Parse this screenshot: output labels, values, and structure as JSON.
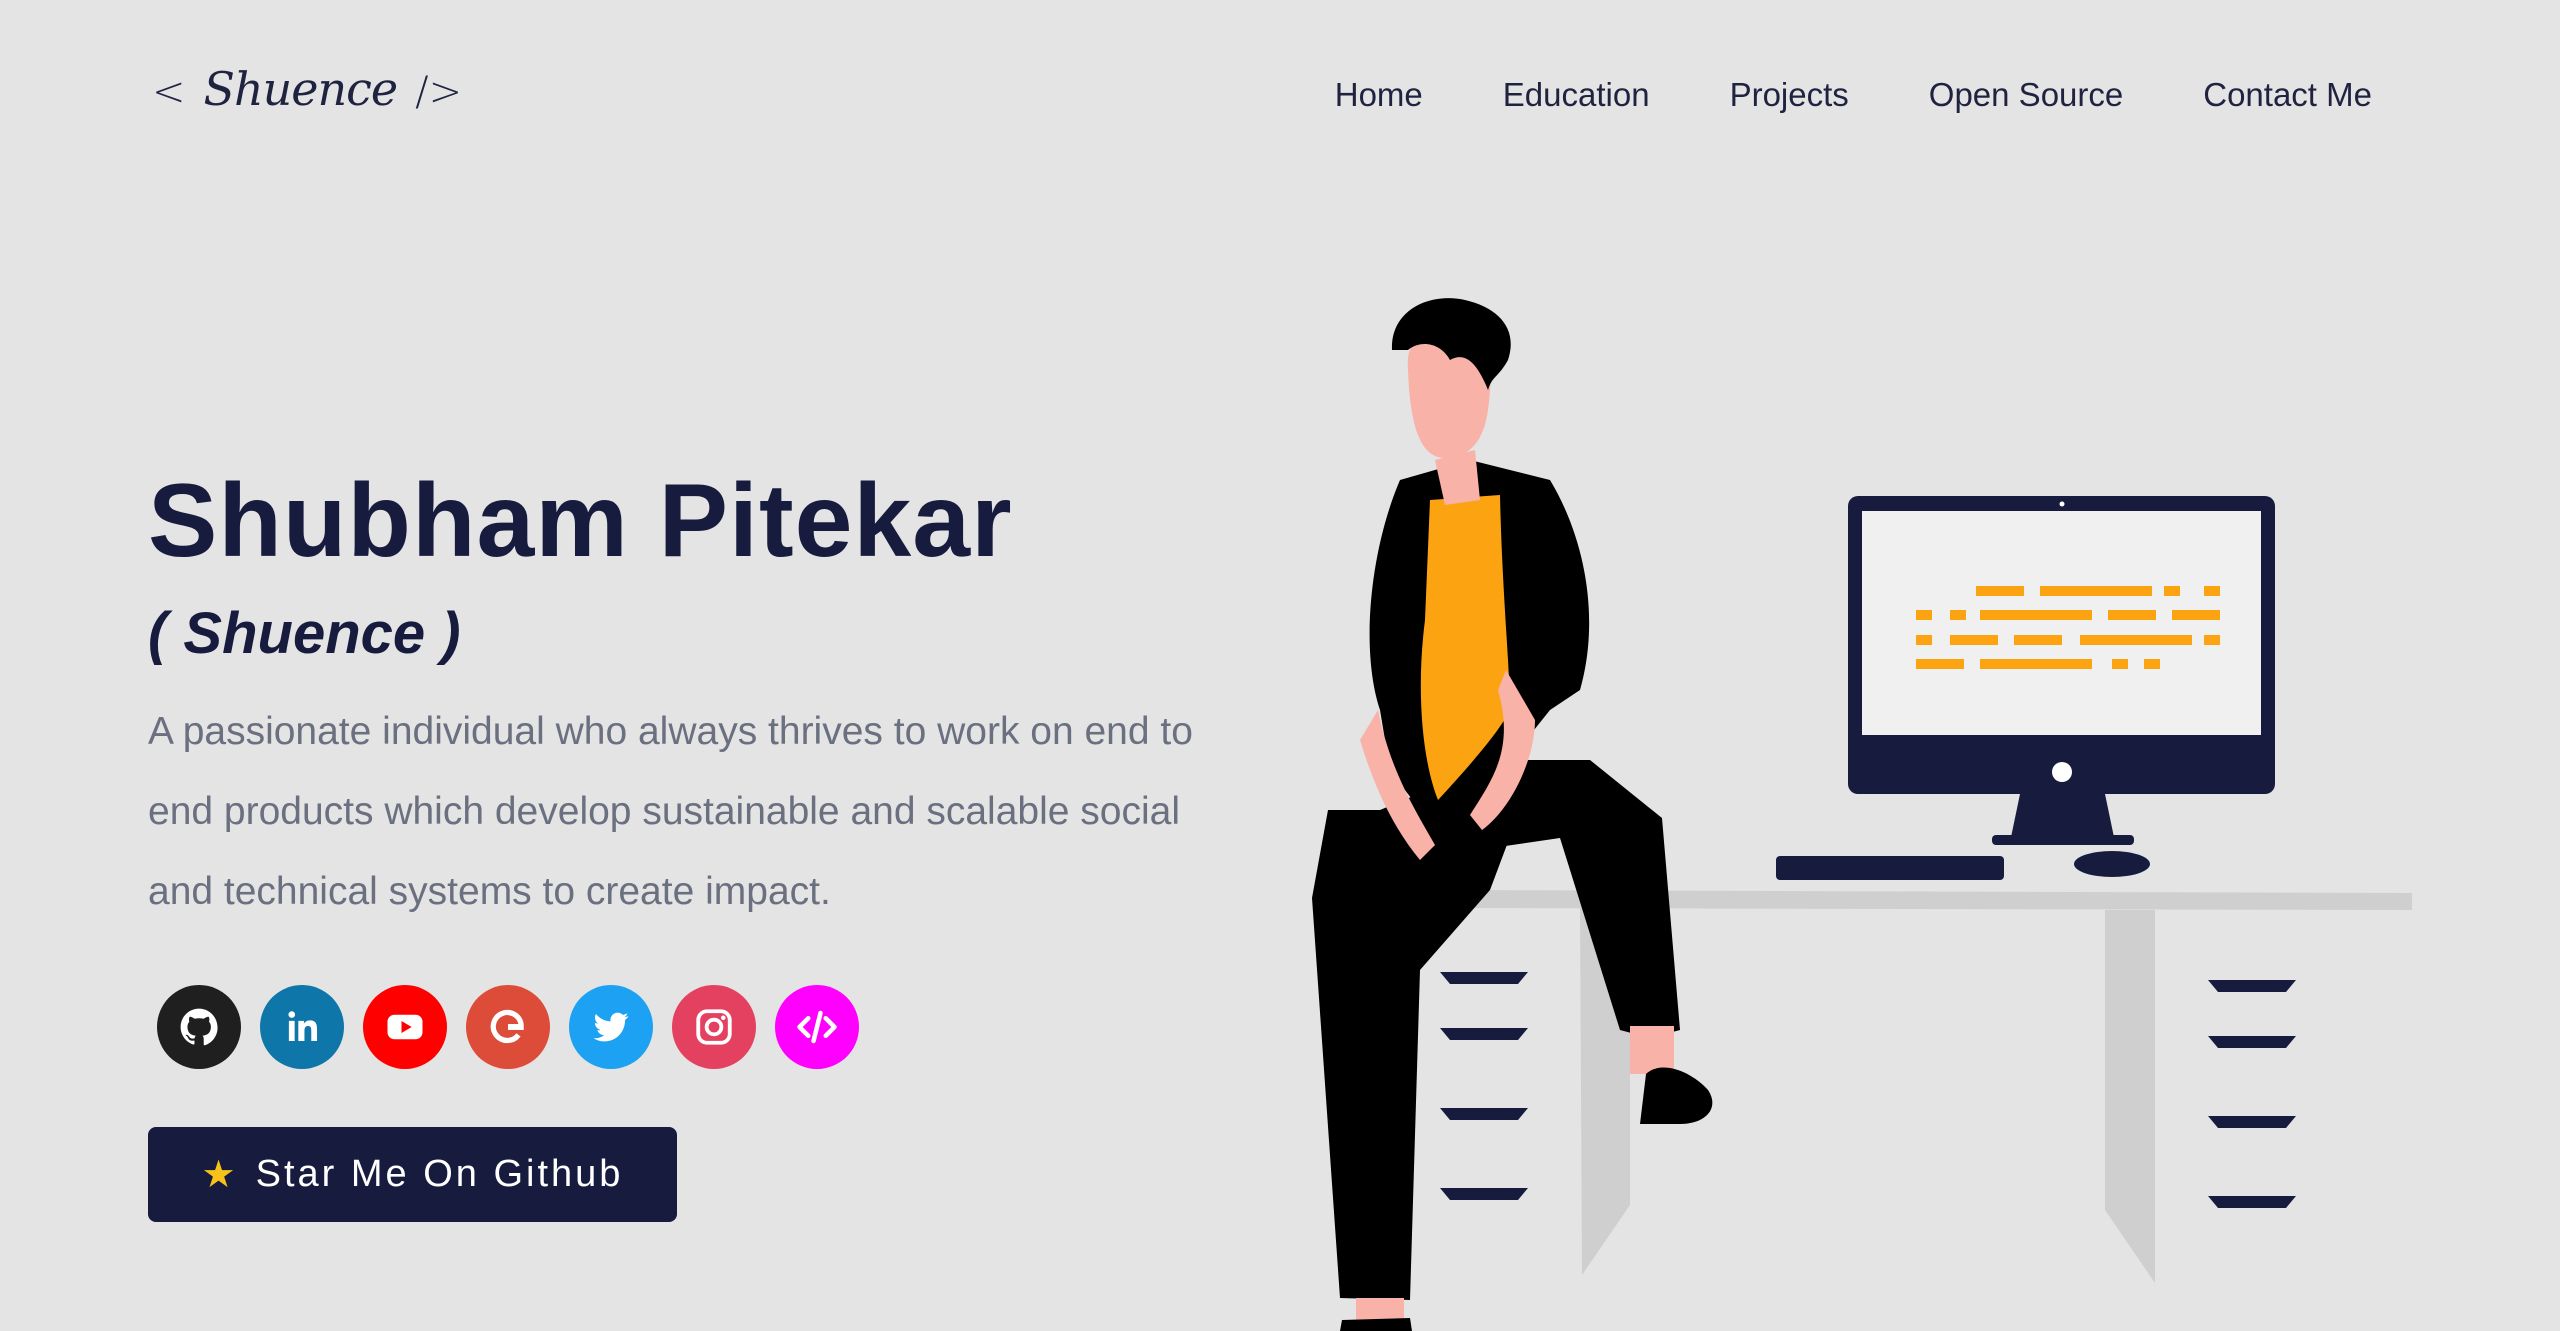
{
  "header": {
    "logo": {
      "open": "<",
      "name": "Shuence",
      "close": "/>"
    },
    "nav": [
      {
        "label": "Home"
      },
      {
        "label": "Education"
      },
      {
        "label": "Projects"
      },
      {
        "label": "Open Source"
      },
      {
        "label": "Contact Me"
      }
    ]
  },
  "hero": {
    "name": "Shubham Pitekar",
    "alias": "( Shuence )",
    "description": "A passionate individual who always thrives to work on end to end products which develop sustainable and scalable social and technical systems to create impact.",
    "socials": [
      {
        "icon": "github-icon",
        "color": "#1f1f1f"
      },
      {
        "icon": "linkedin-icon",
        "color": "#0e76a8"
      },
      {
        "icon": "youtube-icon",
        "color": "#ff0000"
      },
      {
        "icon": "google-icon",
        "color": "#dd4b39"
      },
      {
        "icon": "twitter-icon",
        "color": "#1da1f2"
      },
      {
        "icon": "instagram-icon",
        "color": "#e4405f"
      },
      {
        "icon": "code-icon",
        "color": "#ff00ff"
      }
    ],
    "cta": {
      "icon": "star-icon",
      "label": "Star Me On Github"
    }
  },
  "colors": {
    "background": "#e4e4e4",
    "primary": "#171c3e",
    "body_text": "#6b7080",
    "accent": "#fca311"
  }
}
